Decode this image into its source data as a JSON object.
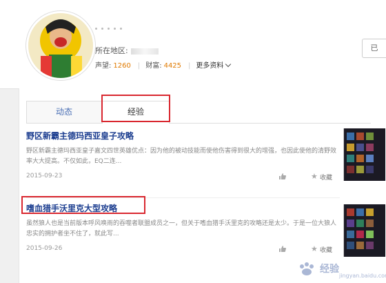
{
  "profile": {
    "region_label": "所在地区:",
    "reputation_label": "声望:",
    "reputation_value": "1260",
    "wealth_label": "财富:",
    "wealth_value": "4425",
    "more_label": "更多资料",
    "right_button_glyph": "已"
  },
  "tabs": [
    {
      "label": "动态"
    },
    {
      "label": "经验"
    }
  ],
  "articles": [
    {
      "title": "野区新霸主德玛西亚皇子攻略",
      "desc": "野区新霸主德玛西亚皇子嘉文四世英雄优点：因为他的被动技能而使他伤害得到很大的增强，也因此使他的清野效率大大提高。不仅如此，EQ二连...",
      "date": "2015-09-23",
      "fav": "收藏"
    },
    {
      "title": "嗜血猎手沃里克大型攻略",
      "desc": "虽然狼人也是当前版本呼风唤雨的吞噬者联盟成员之一，但关于嗜血猎手沃里克的攻略还是太少。于是一位大狼人忠实的拥护者坐不住了，就此写...",
      "date": "2015-09-26",
      "fav": "收藏"
    }
  ],
  "watermark": {
    "text": "经验",
    "sub": "jingyan.baidu.com"
  },
  "colors": {
    "highlight": "#d9262e",
    "title": "#1a3c8f",
    "number": "#e07a00"
  }
}
